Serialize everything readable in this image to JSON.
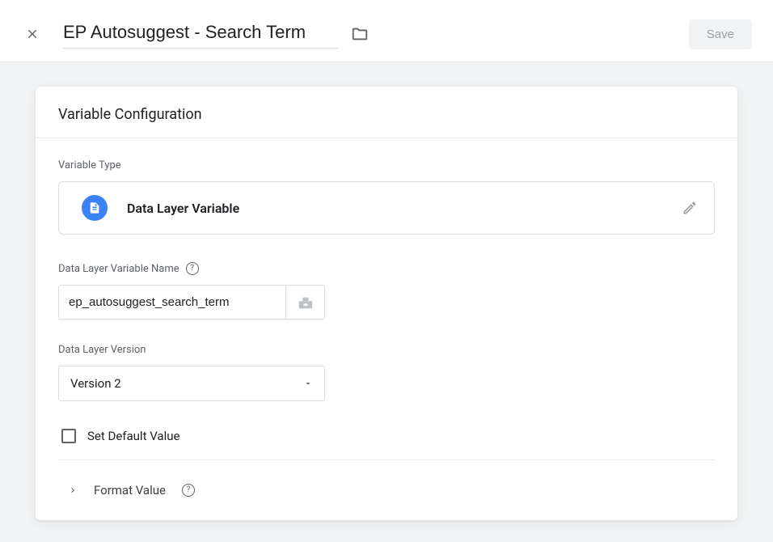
{
  "header": {
    "title": "EP Autosuggest - Search Term",
    "save_label": "Save"
  },
  "card": {
    "title": "Variable Configuration"
  },
  "variable_type": {
    "label": "Variable Type",
    "name": "Data Layer Variable"
  },
  "dlv_name": {
    "label": "Data Layer Variable Name",
    "value": "ep_autosuggest_search_term"
  },
  "dlv_version": {
    "label": "Data Layer Version",
    "selected": "Version 2"
  },
  "set_default": {
    "label": "Set Default Value",
    "checked": false
  },
  "format_value": {
    "label": "Format Value"
  }
}
